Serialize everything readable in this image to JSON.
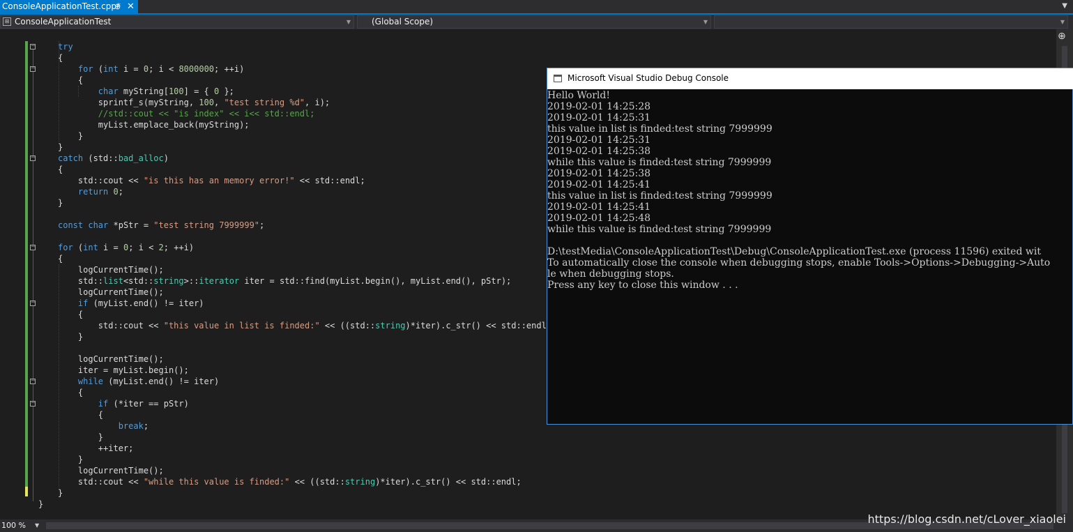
{
  "tab": {
    "title": "ConsoleApplicationTest.cpp*",
    "pin": "⊕",
    "close": "✕"
  },
  "navbar": {
    "project": "ConsoleApplicationTest",
    "scope": "(Global Scope)",
    "member": ""
  },
  "code_lines": [
    [
      [
        "kw",
        "try"
      ]
    ],
    [
      [
        "",
        "{"
      ]
    ],
    [
      [
        "",
        "    "
      ],
      [
        "kw",
        "for"
      ],
      [
        "",
        " ("
      ],
      [
        "kw",
        "int"
      ],
      [
        "",
        " i = "
      ],
      [
        "nm",
        "0"
      ],
      [
        "",
        "; i < "
      ],
      [
        "nm",
        "8000000"
      ],
      [
        "",
        "; ++i)"
      ]
    ],
    [
      [
        "",
        "    {"
      ]
    ],
    [
      [
        "",
        "        "
      ],
      [
        "kw",
        "char"
      ],
      [
        "",
        " myString["
      ],
      [
        "nm",
        "100"
      ],
      [
        "",
        "] = { "
      ],
      [
        "nm",
        "0"
      ],
      [
        "",
        " };"
      ]
    ],
    [
      [
        "",
        "        sprintf_s(myString, "
      ],
      [
        "nm",
        "100"
      ],
      [
        "",
        ", "
      ],
      [
        "st",
        "\"test string %d\""
      ],
      [
        "",
        ", i);"
      ]
    ],
    [
      [
        "",
        "        "
      ],
      [
        "cm",
        "//std::cout << \"is index\" << i<< std::endl;"
      ]
    ],
    [
      [
        "",
        "        myList.emplace_back(myString);"
      ]
    ],
    [
      [
        "",
        "    }"
      ]
    ],
    [
      [
        "",
        "}"
      ]
    ],
    [
      [
        "kw",
        "catch"
      ],
      [
        "",
        " (std::"
      ],
      [
        "ty",
        "bad_alloc"
      ],
      [
        "",
        ")"
      ]
    ],
    [
      [
        "",
        "{"
      ]
    ],
    [
      [
        "",
        "    std::cout << "
      ],
      [
        "st",
        "\"is this has an memory error!\""
      ],
      [
        "",
        " << std::endl;"
      ]
    ],
    [
      [
        "",
        "    "
      ],
      [
        "kw",
        "return"
      ],
      [
        "",
        " "
      ],
      [
        "nm",
        "0"
      ],
      [
        "",
        ";"
      ]
    ],
    [
      [
        "",
        "}"
      ]
    ],
    [
      [
        "",
        ""
      ]
    ],
    [
      [
        "kw",
        "const"
      ],
      [
        "",
        " "
      ],
      [
        "kw",
        "char"
      ],
      [
        "",
        " *pStr = "
      ],
      [
        "st",
        "\"test string 7999999\""
      ],
      [
        "",
        ";"
      ]
    ],
    [
      [
        "",
        ""
      ]
    ],
    [
      [
        "kw",
        "for"
      ],
      [
        "",
        " ("
      ],
      [
        "kw",
        "int"
      ],
      [
        "",
        " i = "
      ],
      [
        "nm",
        "0"
      ],
      [
        "",
        "; i < "
      ],
      [
        "nm",
        "2"
      ],
      [
        "",
        "; ++i)"
      ]
    ],
    [
      [
        "",
        "{"
      ]
    ],
    [
      [
        "",
        "    logCurrentTime();"
      ]
    ],
    [
      [
        "",
        "    std::"
      ],
      [
        "ty",
        "list"
      ],
      [
        "",
        "<std::"
      ],
      [
        "ty",
        "string"
      ],
      [
        "",
        ">::"
      ],
      [
        "ty",
        "iterator"
      ],
      [
        "",
        " iter = std::find(myList.begin(), myList.end(), pStr);"
      ]
    ],
    [
      [
        "",
        "    logCurrentTime();"
      ]
    ],
    [
      [
        "",
        "    "
      ],
      [
        "kw",
        "if"
      ],
      [
        "",
        " (myList.end() != iter)"
      ]
    ],
    [
      [
        "",
        "    {"
      ]
    ],
    [
      [
        "",
        "        std::cout << "
      ],
      [
        "st",
        "\"this value in list is finded:\""
      ],
      [
        "",
        " << ((std::"
      ],
      [
        "ty",
        "string"
      ],
      [
        "",
        ")*iter).c_str() << std::endl;"
      ]
    ],
    [
      [
        "",
        "    }"
      ]
    ],
    [
      [
        "",
        ""
      ]
    ],
    [
      [
        "",
        "    logCurrentTime();"
      ]
    ],
    [
      [
        "",
        "    iter = myList.begin();"
      ]
    ],
    [
      [
        "",
        "    "
      ],
      [
        "kw",
        "while"
      ],
      [
        "",
        " (myList.end() != iter)"
      ]
    ],
    [
      [
        "",
        "    {"
      ]
    ],
    [
      [
        "",
        "        "
      ],
      [
        "kw",
        "if"
      ],
      [
        "",
        " (*iter == pStr)"
      ]
    ],
    [
      [
        "",
        "        {"
      ]
    ],
    [
      [
        "",
        "            "
      ],
      [
        "kw",
        "break"
      ],
      [
        "",
        ";"
      ]
    ],
    [
      [
        "",
        "        }"
      ]
    ],
    [
      [
        "",
        "        ++iter;"
      ]
    ],
    [
      [
        "",
        "    }"
      ]
    ],
    [
      [
        "",
        "    logCurrentTime();"
      ]
    ],
    [
      [
        "",
        "    std::cout << "
      ],
      [
        "st",
        "\"while this value is finded:\""
      ],
      [
        "",
        " << ((std::"
      ],
      [
        "ty",
        "string"
      ],
      [
        "",
        ")*iter).c_str() << std::endl;"
      ]
    ],
    [
      [
        "",
        "}"
      ]
    ],
    [
      [
        "",
        "}"
      ]
    ]
  ],
  "console": {
    "title": "Microsoft Visual Studio Debug Console",
    "lines": [
      "Hello World!",
      "2019-02-01 14:25:28",
      "2019-02-01 14:25:31",
      "this value in list is finded:test string 7999999",
      "2019-02-01 14:25:31",
      "2019-02-01 14:25:38",
      "while this value is finded:test string 7999999",
      "2019-02-01 14:25:38",
      "2019-02-01 14:25:41",
      "this value in list is finded:test string 7999999",
      "2019-02-01 14:25:41",
      "2019-02-01 14:25:48",
      "while this value is finded:test string 7999999",
      "",
      "D:\\testMedia\\ConsoleApplicationTest\\Debug\\ConsoleApplicationTest.exe (process 11596) exited wit",
      "To automatically close the console when debugging stops, enable Tools->Options->Debugging->Auto",
      "le when debugging stops.",
      "Press any key to close this window . . ."
    ]
  },
  "statusbar": {
    "zoom": "100 %"
  },
  "watermark": "https://blog.csdn.net/cLover_xiaolei",
  "colors": {
    "accent": "#007acc",
    "keyword": "#569cd6",
    "type": "#4ec9b0",
    "string": "#d69d85",
    "comment": "#57a64a",
    "number": "#b5cea8"
  }
}
